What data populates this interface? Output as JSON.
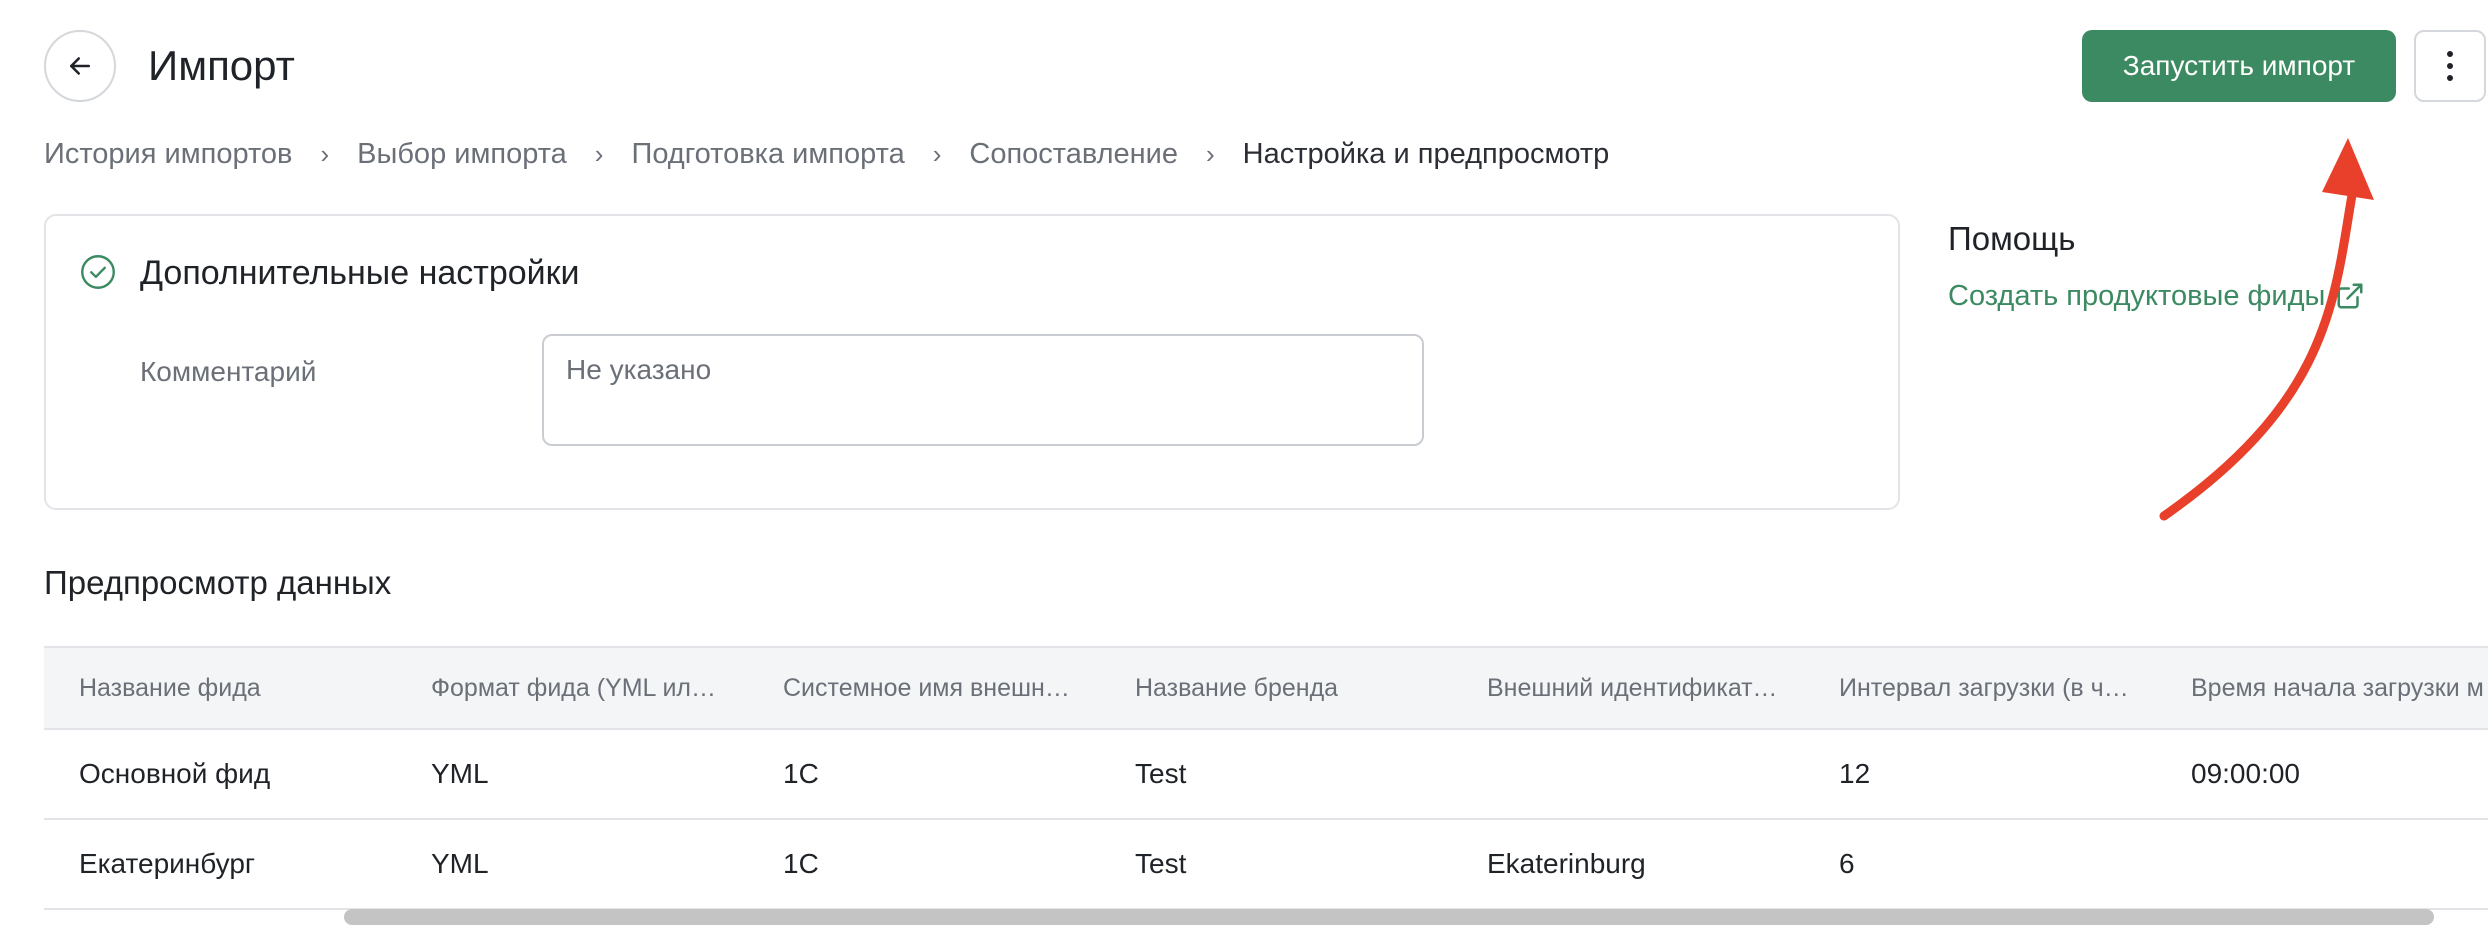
{
  "header": {
    "title": "Импорт",
    "run_label": "Запустить импорт"
  },
  "breadcrumbs": [
    {
      "label": "История импортов"
    },
    {
      "label": "Выбор импорта"
    },
    {
      "label": "Подготовка импорта"
    },
    {
      "label": "Сопоставление"
    },
    {
      "label": "Настройка и предпросмотр"
    }
  ],
  "settings": {
    "title": "Дополнительные настройки",
    "comment_label": "Комментарий",
    "comment_placeholder": "Не указано"
  },
  "help": {
    "title": "Помощь",
    "link_label": "Создать продуктовые фиды"
  },
  "preview": {
    "title": "Предпросмотр данных",
    "columns": [
      "Название фида",
      "Формат фида (YML или G...",
      "Системное имя внешней...",
      "Название бренда",
      "Внешний идентификатор ...",
      "Интервал загрузки (в час...",
      "Время начала загрузки м"
    ],
    "rows": [
      [
        "Основной фид",
        "YML",
        "1C",
        "Test",
        "",
        "12",
        "09:00:00"
      ],
      [
        "Екатеринбург",
        "YML",
        "1C",
        "Test",
        "Ekaterinburg",
        "6",
        ""
      ]
    ]
  },
  "colors": {
    "accent": "#3c8a62",
    "annotation_arrow": "#e8402a"
  },
  "icons": {
    "back": "arrow-left-icon",
    "more": "more-vertical-icon",
    "check": "check-circle-icon",
    "external": "external-link-icon"
  }
}
